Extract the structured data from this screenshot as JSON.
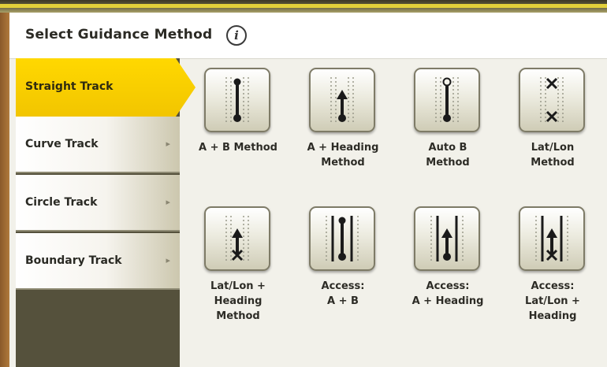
{
  "header": {
    "title": "Select Guidance Method",
    "info_icon": "i"
  },
  "sidebar": {
    "tabs": [
      {
        "label": "Straight Track",
        "active": true
      },
      {
        "label": "Curve Track",
        "arrow": "▸"
      },
      {
        "label": "Circle Track",
        "arrow": "▸"
      },
      {
        "label": "Boundary Track",
        "arrow": "▸"
      }
    ]
  },
  "methods": [
    {
      "caption": "A + B Method",
      "icon": "ab-line-icon"
    },
    {
      "caption": "A + Heading\nMethod",
      "icon": "a-heading-icon"
    },
    {
      "caption": "Auto B\nMethod",
      "icon": "auto-b-icon"
    },
    {
      "caption": "Lat/Lon\nMethod",
      "icon": "lat-lon-icon"
    },
    {
      "caption": "Lat/Lon +\nHeading\nMethod",
      "icon": "lat-lon-heading-icon"
    },
    {
      "caption": "Access:\nA + B",
      "icon": "access-ab-icon"
    },
    {
      "caption": "Access:\nA + Heading",
      "icon": "access-a-heading-icon"
    },
    {
      "caption": "Access:\nLat/Lon +\nHeading",
      "icon": "access-lat-lon-heading-icon"
    }
  ],
  "colors": {
    "active_tab": "#f2c500",
    "sidebar_bg": "#55513c",
    "accent_bar": "#e2d03a"
  }
}
